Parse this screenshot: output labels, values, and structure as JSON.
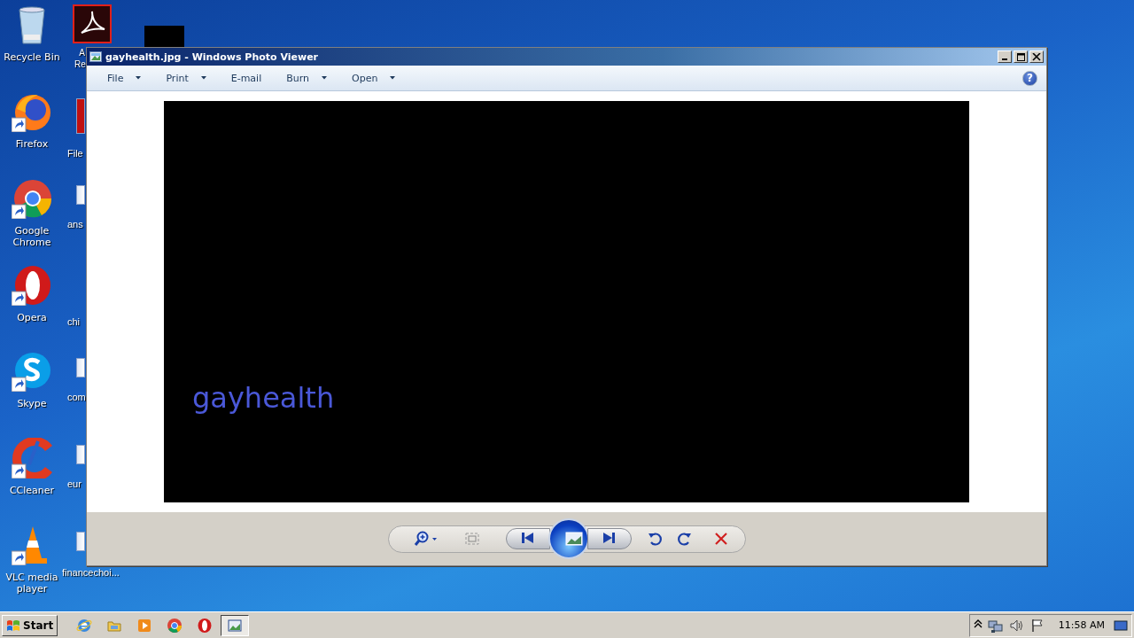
{
  "desktop": {
    "icons": [
      {
        "label": "Recycle Bin",
        "kind": "recycle"
      },
      {
        "label": "Firefox",
        "kind": "firefox"
      },
      {
        "label": "Google Chrome",
        "kind": "chrome"
      },
      {
        "label": "Opera",
        "kind": "opera"
      },
      {
        "label": "Skype",
        "kind": "skype"
      },
      {
        "label": "CCleaner",
        "kind": "ccleaner"
      },
      {
        "label": "VLC media player",
        "kind": "vlc"
      }
    ],
    "partial_icons": [
      {
        "label": "A Re",
        "kind": "acrobat"
      },
      {
        "label": "File",
        "kind": "app"
      },
      {
        "label": "ans",
        "kind": "document"
      },
      {
        "label": "chi",
        "kind": "blank"
      },
      {
        "label": "com",
        "kind": "document"
      },
      {
        "label": "eur",
        "kind": "document"
      },
      {
        "label": "financechoi...",
        "kind": "document"
      }
    ]
  },
  "window": {
    "title": "gayhealth.jpg - Windows Photo Viewer",
    "menu": [
      {
        "label": "File",
        "dropdown": true
      },
      {
        "label": "Print",
        "dropdown": true
      },
      {
        "label": "E-mail",
        "dropdown": false
      },
      {
        "label": "Burn",
        "dropdown": true
      },
      {
        "label": "Open",
        "dropdown": true
      }
    ],
    "help": "?",
    "image": {
      "text": "gayhealth"
    },
    "controls": [
      {
        "kind": "zoom"
      },
      {
        "kind": "fit"
      },
      {
        "kind": "prev"
      },
      {
        "kind": "slideshow"
      },
      {
        "kind": "next"
      },
      {
        "kind": "rotate-left"
      },
      {
        "kind": "rotate-right"
      },
      {
        "kind": "delete"
      }
    ]
  },
  "taskbar": {
    "start": "Start",
    "apps": [
      {
        "kind": "ie",
        "selected": false
      },
      {
        "kind": "explorer",
        "selected": false
      },
      {
        "kind": "media",
        "selected": false
      },
      {
        "kind": "chrome",
        "selected": false
      },
      {
        "kind": "opera",
        "selected": false
      },
      {
        "kind": "photo",
        "selected": true
      }
    ],
    "clock": "11:58 AM"
  }
}
